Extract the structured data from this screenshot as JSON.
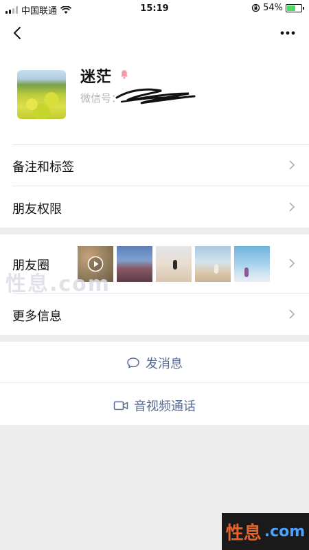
{
  "status_bar": {
    "carrier": "中国联通",
    "time": "15:19",
    "battery": "54%",
    "battery_level": 0.54
  },
  "profile": {
    "name": "迷茫",
    "wechat_id_label": "微信号："
  },
  "rows": {
    "remark": "备注和标签",
    "friend_perm": "朋友权限",
    "moments": "朋友圈",
    "more_info": "更多信息"
  },
  "actions": {
    "message": "发消息",
    "call": "音视频通话"
  },
  "watermark": {
    "mid": "性息.com",
    "left": "性息",
    "right": ".com"
  },
  "colors": {
    "link": "#576b95",
    "background": "#ededed",
    "battery_fill": "#4cd964"
  },
  "icons": [
    "signal-icon",
    "wifi-icon",
    "lock-rotation-icon",
    "battery-icon",
    "back-icon",
    "more-icon",
    "female-icon",
    "chevron-right-icon",
    "play-icon",
    "chat-bubble-icon",
    "video-camera-icon"
  ]
}
